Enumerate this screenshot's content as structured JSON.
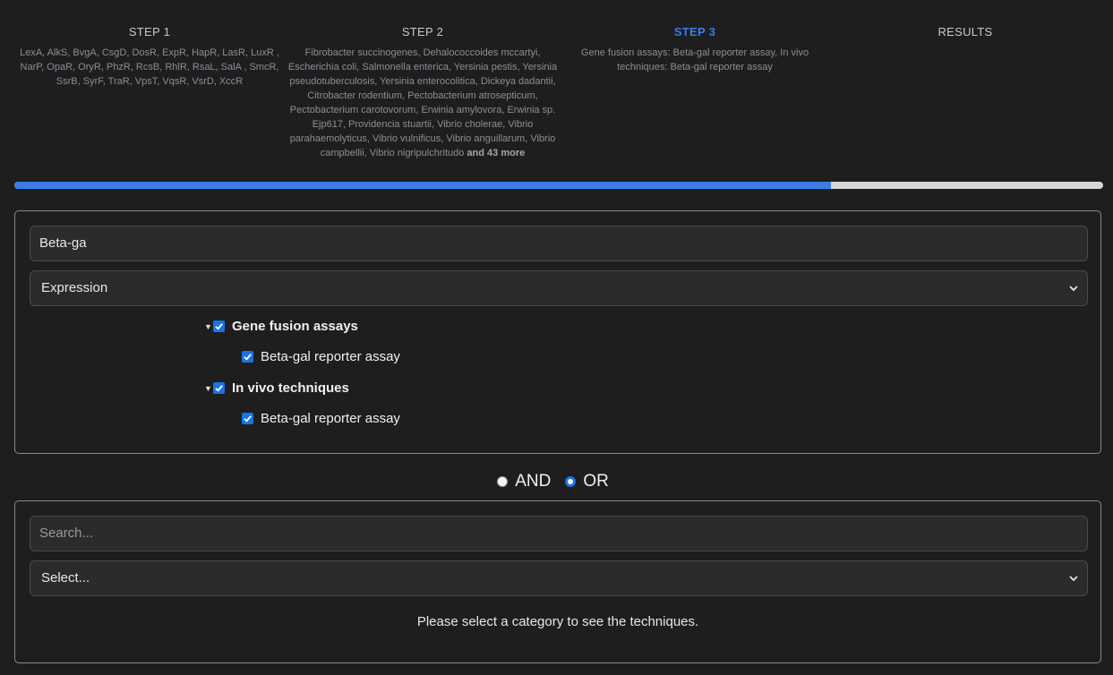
{
  "steps": [
    {
      "title": "STEP 1",
      "description": "LexA, AlkS, BvgA, CsgD, DosR, ExpR, HapR, LasR, LuxR , NarP, OpaR, OryR, PhzR, RcsB, RhlR, RsaL, SalA , SmcR, SsrB, SyrF, TraR, VpsT, VqsR, VsrD, XccR"
    },
    {
      "title": "STEP 2",
      "description": "Fibrobacter succinogenes, Dehalococcoides mccartyi, Escherichia coli, Salmonella enterica, Yersinia pestis, Yersinia pseudotuberculosis, Yersinia enterocolitica, Dickeya dadantii, Citrobacter rodentium, Pectobacterium atrosepticum, Pectobacterium carotovorum, Erwinia amylovora, Erwinia sp. Ejp617, Providencia stuartii, Vibrio cholerae, Vibrio parahaemolyticus, Vibrio vulnificus, Vibrio anguillarum, Vibrio campbellii, Vibrio nigripulchritudo",
      "more": "and 43 more"
    },
    {
      "title": "STEP 3",
      "description": "Gene fusion assays: Beta-gal reporter assay, In vivo techniques: Beta-gal reporter assay"
    },
    {
      "title": "RESULTS",
      "description": ""
    }
  ],
  "progress": {
    "percent": 75
  },
  "colors": {
    "accent": "#3b7ce8",
    "checkbox": "#1a73e8",
    "track": "#d6d6d6",
    "background": "#1e1e1e"
  },
  "panel1": {
    "search_value": "Beta-ga",
    "category_selected": "Expression",
    "tree": [
      {
        "group": "Gene fusion assays",
        "checked": true,
        "expanded": true,
        "items": [
          {
            "label": "Beta-gal reporter assay",
            "checked": true
          }
        ]
      },
      {
        "group": "In vivo techniques",
        "checked": true,
        "expanded": true,
        "items": [
          {
            "label": "Beta-gal reporter assay",
            "checked": true
          }
        ]
      }
    ]
  },
  "logic": {
    "and_label": "AND",
    "or_label": "OR",
    "selected": "OR"
  },
  "panel2": {
    "search_placeholder": "Search...",
    "category_selected": "Select...",
    "hint": "Please select a category to see the techniques."
  },
  "icons": {
    "caret": "caret-down-icon",
    "check": "check-icon",
    "chevron": "chevron-down-icon"
  }
}
